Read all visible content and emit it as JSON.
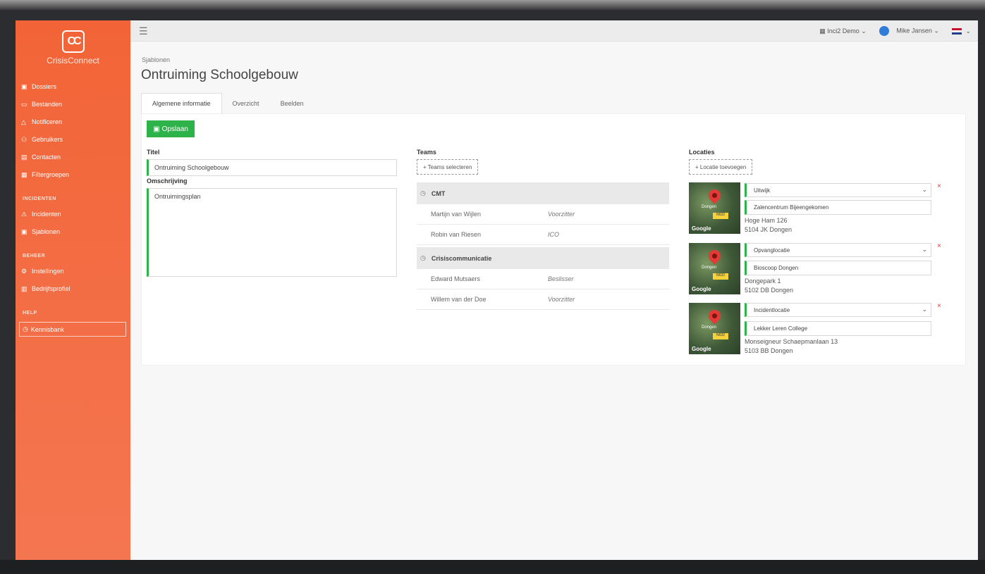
{
  "app": {
    "brand": "CrisisConnect",
    "logo_text": "CC"
  },
  "sidebar": {
    "items": [
      {
        "label": "Dossiers",
        "icon": "folder-icon"
      },
      {
        "label": "Bestanden",
        "icon": "file-icon"
      },
      {
        "label": "Notificeren",
        "icon": "bell-icon"
      },
      {
        "label": "Gebruikers",
        "icon": "users-icon"
      },
      {
        "label": "Contacten",
        "icon": "contact-card-icon"
      },
      {
        "label": "Filtergroepen",
        "icon": "filter-icon"
      }
    ],
    "section_incidents": "INCIDENTEN",
    "incident_items": [
      {
        "label": "Incidenten",
        "icon": "warning-icon"
      },
      {
        "label": "Sjablonen",
        "icon": "template-icon"
      }
    ],
    "section_beheer": "BEHEER",
    "beheer_items": [
      {
        "label": "Instellingen",
        "icon": "settings-icon"
      },
      {
        "label": "Bedrijfsprofiel",
        "icon": "building-icon"
      }
    ],
    "section_help": "HELP",
    "help_item": {
      "label": "Kennisbank",
      "icon": "help-circle-icon"
    }
  },
  "topbar": {
    "org": "Inci2 Demo",
    "user": "Mike Jansen",
    "language_flag": "flag-nl-icon"
  },
  "page": {
    "breadcrumb": "Sjablonen",
    "title": "Ontruiming Schoolgebouw",
    "tabs": [
      "Algemene informatie",
      "Overzicht",
      "Beelden"
    ],
    "save_label": "Opslaan"
  },
  "form": {
    "title_label": "Titel",
    "title_value": "Ontruiming Schoolgebouw",
    "description_label": "Omschrijving",
    "description_value": "Ontruimingsplan"
  },
  "teams": {
    "label": "Teams",
    "select_button": "+ Teams selecteren",
    "groups": [
      {
        "name": "CMT",
        "members": [
          {
            "name": "Martijn van Wijlen",
            "role": "Voorzitter"
          },
          {
            "name": "Robin van Riesen",
            "role": "ICO"
          }
        ]
      },
      {
        "name": "Crisiscommunicatie",
        "members": [
          {
            "name": "Edward Mutsaers",
            "role": "Beslisser"
          },
          {
            "name": "Willem van der Doe",
            "role": "Voorzitter"
          }
        ]
      }
    ]
  },
  "locations": {
    "label": "Locaties",
    "add_button": "+ Locatie toevoegen",
    "items": [
      {
        "type": "Uitwijk",
        "name": "Zalencentrum Bijeengekomen",
        "street": "Hoge Ham 126",
        "postal": "5104 JK Dongen"
      },
      {
        "type": "Opvanglocatie",
        "name": "Bioscoop Dongen",
        "street": "Dongepark 1",
        "postal": "5102 DB Dongen"
      },
      {
        "type": "Incidentlocatie",
        "name": "Lekker Leren College",
        "street": "Monseigneur Schaepmanlaan 13",
        "postal": "5103 BB Dongen"
      }
    ],
    "map_city": "Dongen",
    "map_road": "N632",
    "map_provider": "Google"
  },
  "colors": {
    "sidebar": "#f26437",
    "accent_green": "#2db34a",
    "remove_red": "#e53935"
  }
}
